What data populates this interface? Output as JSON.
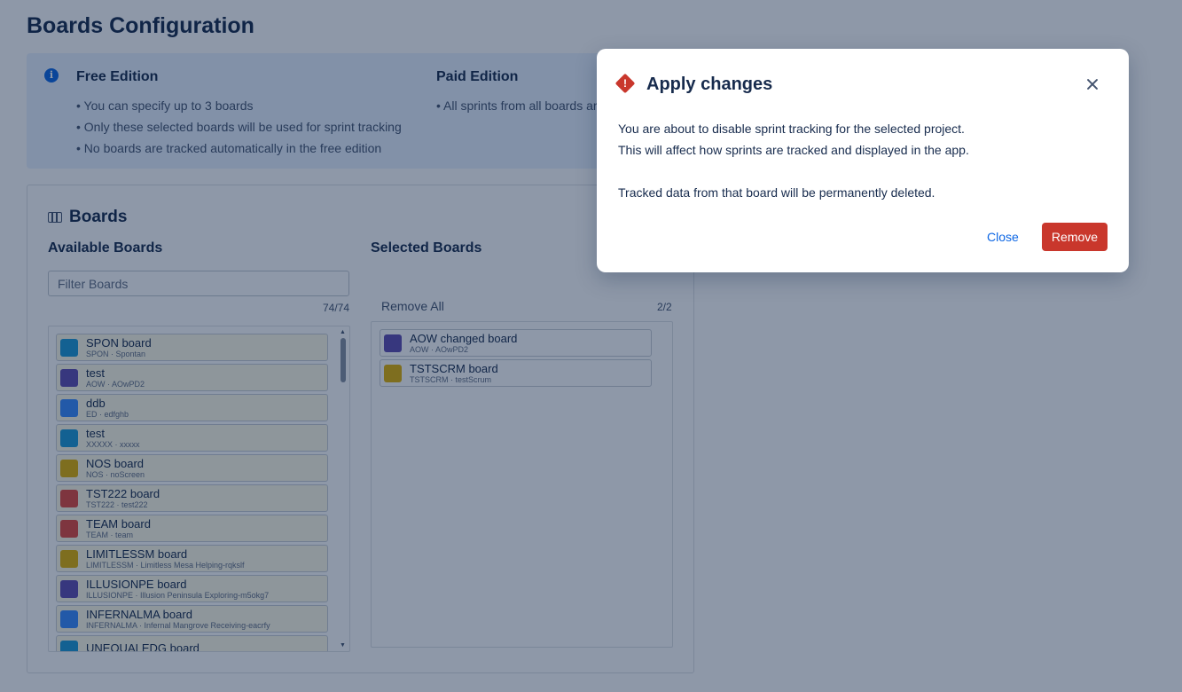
{
  "page": {
    "title": "Boards Configuration"
  },
  "info": {
    "free": {
      "title": "Free Edition",
      "items": [
        "You can specify up to 3 boards",
        "Only these selected boards will be used for sprint tracking",
        "No boards are tracked automatically in the free edition"
      ]
    },
    "paid": {
      "title": "Paid Edition",
      "items": [
        "All sprints from all boards are"
      ]
    }
  },
  "boards": {
    "title": "Boards",
    "available": {
      "title": "Available Boards",
      "filter_placeholder": "Filter Boards",
      "count": "74/74",
      "items": [
        {
          "name": "SPON board",
          "sub": "SPON · Spontan",
          "color": "#1d9ad6"
        },
        {
          "name": "test",
          "sub": "AOW · AOwPD2",
          "color": "#5e4db2"
        },
        {
          "name": "ddb",
          "sub": "ED · edfghb",
          "color": "#388bff"
        },
        {
          "name": "test",
          "sub": "XXXXX · xxxxx",
          "color": "#1d9ad6"
        },
        {
          "name": "NOS board",
          "sub": "NOS · noScreen",
          "color": "#e2b203"
        },
        {
          "name": "TST222 board",
          "sub": "TST222 · test222",
          "color": "#e2483d"
        },
        {
          "name": "TEAM board",
          "sub": "TEAM · team",
          "color": "#e2483d"
        },
        {
          "name": "LIMITLESSM board",
          "sub": "LIMITLESSM · Limitless Mesa Helping-rqkslf",
          "color": "#e2b203"
        },
        {
          "name": "ILLUSIONPE board",
          "sub": "ILLUSIONPE · Illusion Peninsula Exploring-m5okg7",
          "color": "#5e4db2"
        },
        {
          "name": "INFERNALMA board",
          "sub": "INFERNALMA · Infernal Mangrove Receiving-eacrfy",
          "color": "#388bff"
        },
        {
          "name": "UNEQUALEDG board",
          "sub": "",
          "color": "#1d9ad6"
        }
      ]
    },
    "selected": {
      "title": "Selected Boards",
      "remove_all": "Remove All",
      "count": "2/2",
      "items": [
        {
          "name": "AOW changed board",
          "sub": "AOW · AOwPD2",
          "color": "#5e4db2"
        },
        {
          "name": "TSTSCRM board",
          "sub": "TSTSCRM · testScrum",
          "color": "#e2b203"
        }
      ]
    }
  },
  "modal": {
    "title": "Apply changes",
    "line1": "You are about to disable sprint tracking for the selected project.",
    "line2": "This will affect how sprints are tracked and displayed in the app.",
    "line3": "Tracked data from that board will be permanently deleted.",
    "close_label": "Close",
    "remove_label": "Remove",
    "warning_glyph": "!"
  }
}
